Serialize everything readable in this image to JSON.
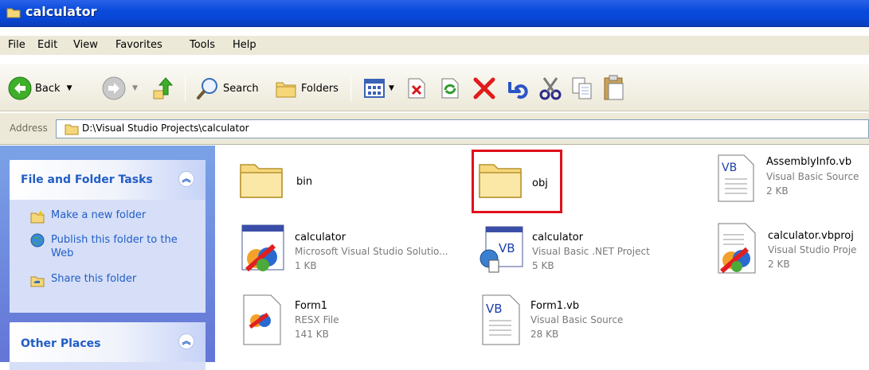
{
  "window": {
    "title": "calculator"
  },
  "menu": [
    "File",
    "Edit",
    "View",
    "Favorites",
    "Tools",
    "Help"
  ],
  "toolbar": {
    "back_label": "Back",
    "search_label": "Search",
    "folders_label": "Folders"
  },
  "address": {
    "label": "Address",
    "path": "D:\\Visual Studio Projects\\calculator"
  },
  "left_pane": {
    "file_tasks": {
      "title": "File and Folder Tasks",
      "items": [
        "Make a new folder",
        "Publish this folder to the Web",
        "Share this folder"
      ]
    },
    "other_places": {
      "title": "Other Places"
    }
  },
  "files": [
    {
      "name": "bin",
      "type": "",
      "size": "",
      "icon": "folder-icon"
    },
    {
      "name": "obj",
      "type": "",
      "size": "",
      "icon": "folder-icon"
    },
    {
      "name": "AssemblyInfo.vb",
      "type": "Visual Basic Source",
      "size": "2 KB",
      "icon": "vb-file-icon"
    },
    {
      "name": "calculator",
      "type": "Microsoft Visual Studio Solutio...",
      "size": "1 KB",
      "icon": "vs-solution-icon"
    },
    {
      "name": "calculator",
      "type": "Visual Basic .NET Project",
      "size": "5 KB",
      "icon": "vb-project-icon"
    },
    {
      "name": "calculator.vbproj",
      "type": "Visual Studio Proje",
      "size": "2 KB",
      "icon": "vs-project-file-icon"
    },
    {
      "name": "Form1",
      "type": "RESX File",
      "size": "141 KB",
      "icon": "resx-file-icon"
    },
    {
      "name": "Form1.vb",
      "type": "Visual Basic Source",
      "size": "28 KB",
      "icon": "vb-file-icon"
    }
  ],
  "colors": {
    "title_bar": "#0a4bdc",
    "task_pane": "#6f8ee0",
    "task_link": "#215dc6",
    "highlight": "#e0101a"
  }
}
